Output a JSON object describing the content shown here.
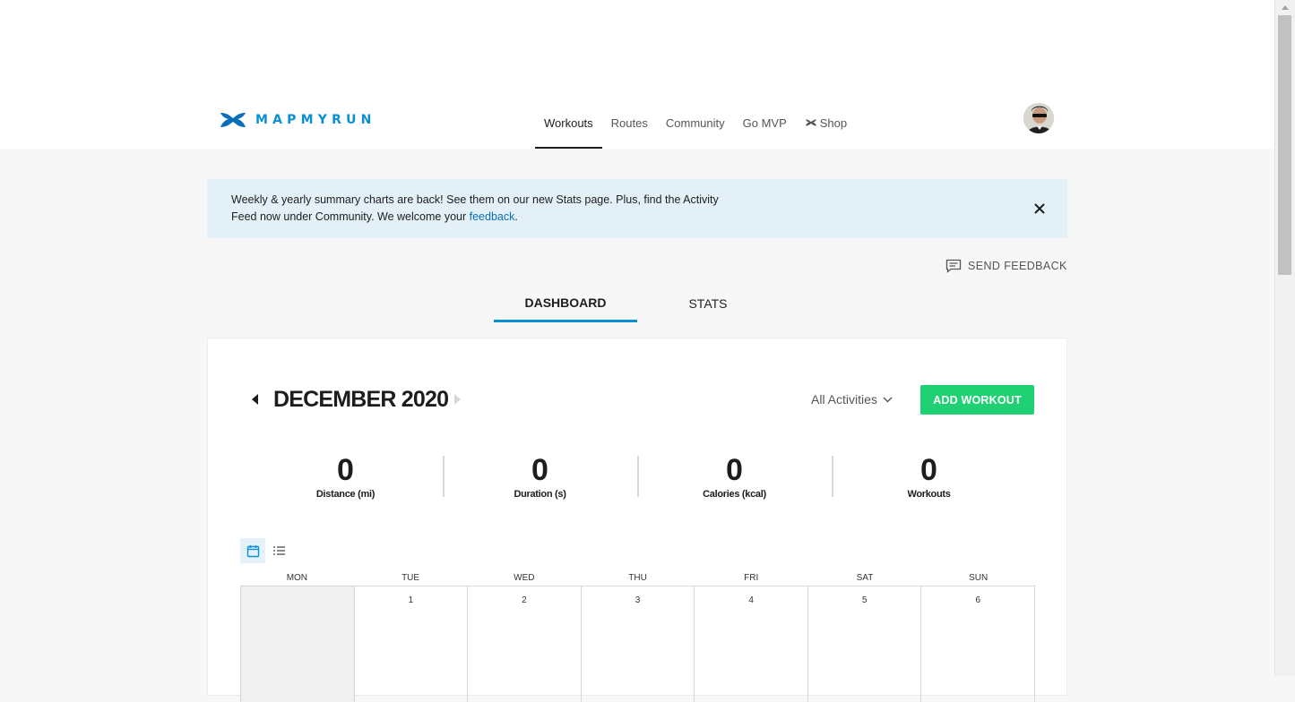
{
  "header": {
    "logo_text": "MAPMYRUN",
    "nav": [
      {
        "label": "Workouts",
        "active": true
      },
      {
        "label": "Routes"
      },
      {
        "label": "Community"
      },
      {
        "label": "Go MVP"
      },
      {
        "label": "Shop",
        "icon": "under-armour-icon"
      }
    ],
    "avatar_icon": "user-avatar"
  },
  "banner": {
    "text": "Weekly & yearly summary charts are back! See them on our new Stats page. Plus, find the Activity Feed now under Community. We welcome your ",
    "link": "feedback",
    "suffix": ".",
    "close_icon": "close-icon",
    "background": "#e3f0f8"
  },
  "send_feedback": {
    "label": "SEND FEEDBACK",
    "icon": "chat-icon"
  },
  "tabs": [
    {
      "label": "DASHBOARD",
      "active": true
    },
    {
      "label": "STATS"
    }
  ],
  "calendar": {
    "month": "DECEMBER 2020",
    "filter": "All Activities",
    "add_button": "ADD WORKOUT",
    "stats": [
      {
        "value": "0",
        "label": "Distance (mi)"
      },
      {
        "value": "0",
        "label": "Duration (s)"
      },
      {
        "value": "0",
        "label": "Calories (kcal)"
      },
      {
        "value": "0",
        "label": "Workouts"
      }
    ],
    "weekdays": [
      "MON",
      "TUE",
      "WED",
      "THU",
      "FRI",
      "SAT",
      "SUN"
    ],
    "days": [
      "",
      "1",
      "2",
      "3",
      "4",
      "5",
      "6"
    ]
  },
  "colors": {
    "brand": "#0a8fd1",
    "add_button": "#1fd173",
    "link": "#0a6fb8"
  }
}
